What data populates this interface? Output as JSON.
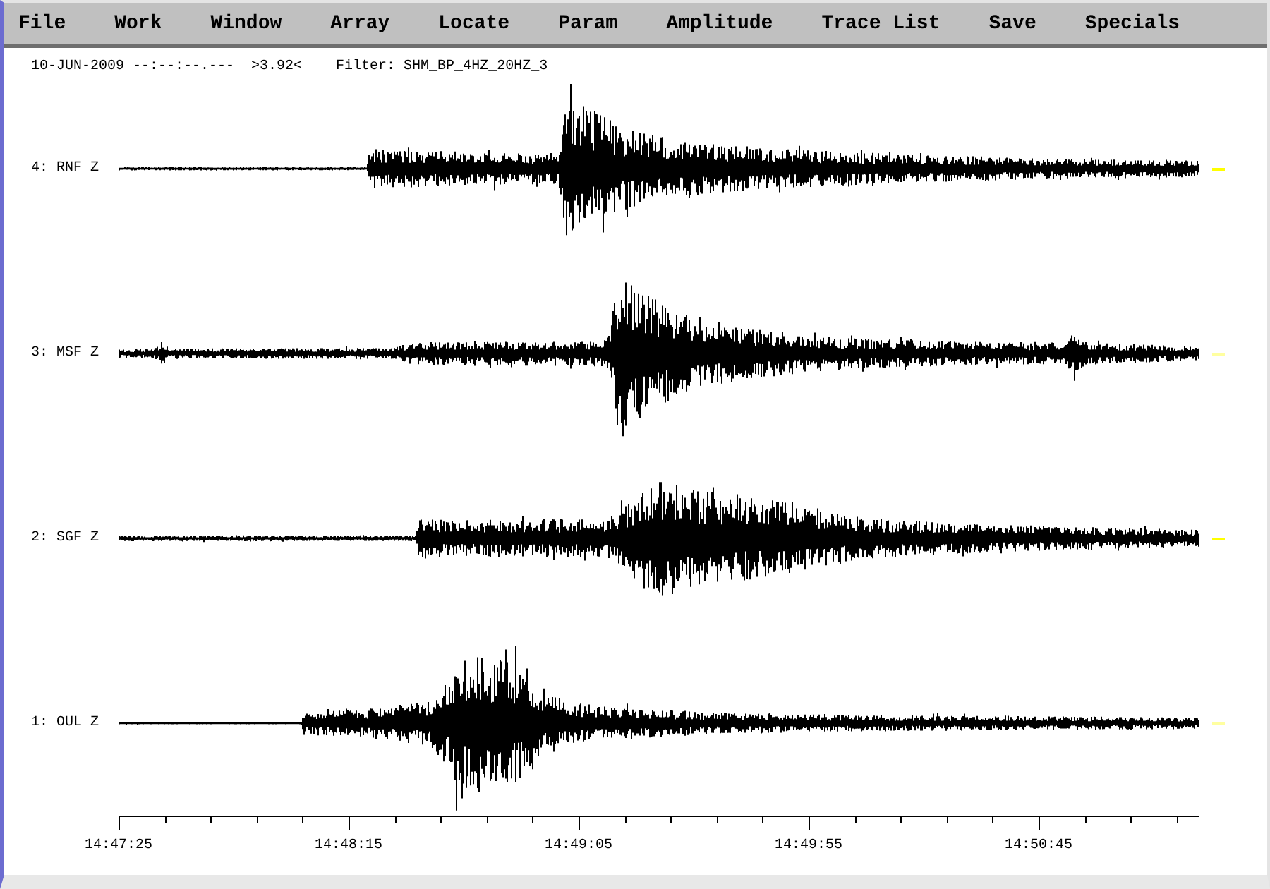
{
  "menu": [
    "File",
    "Work",
    "Window",
    "Array",
    "Locate",
    "Param",
    "Amplitude",
    "Trace List",
    "Save",
    "Specials"
  ],
  "header": {
    "date_time": "10-JUN-2009 --:--:--.---",
    "magnification": ">3.92<",
    "filter": "Filter: SHM_BP_4HZ_20HZ_3"
  },
  "traces": [
    {
      "label": "4: RNF Z",
      "color": "#ffff00"
    },
    {
      "label": "3: MSF Z",
      "color": "#ffffa0"
    },
    {
      "label": "2: SGF Z",
      "color": "#ffff00"
    },
    {
      "label": "1: OUL Z",
      "color": "#ffffa0"
    }
  ],
  "time_axis": [
    "14:47:25",
    "14:48:15",
    "14:49:05",
    "14:49:55",
    "14:50:45"
  ]
}
